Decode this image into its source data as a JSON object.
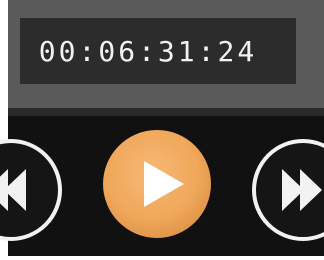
{
  "player": {
    "timecode": "00:06:31:24",
    "play_state": "paused",
    "controls": [
      "rewind-icon",
      "play-icon",
      "fast-forward-icon"
    ],
    "colors": {
      "accent": "#f0a85a",
      "panel": "#5a5a5a",
      "display": "#2c2c2c",
      "control_bar": "#111111"
    }
  }
}
